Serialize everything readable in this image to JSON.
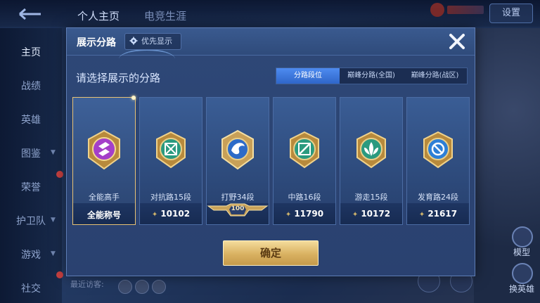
{
  "background": {
    "top_tabs": [
      "个人主页",
      "电竞生涯"
    ],
    "settings_label": "设置",
    "sidebar": [
      {
        "label": "主页",
        "active": true
      },
      {
        "label": "战绩"
      },
      {
        "label": "英雄"
      },
      {
        "label": "图鉴"
      },
      {
        "label": "荣誉"
      },
      {
        "label": "护卫队"
      },
      {
        "label": "游戏"
      },
      {
        "label": "社交"
      }
    ],
    "right_buttons": [
      "模型",
      "换英雄"
    ],
    "recent_visitors_label": "最近访客:"
  },
  "modal": {
    "title": "展示分路",
    "priority_button": "优先显示",
    "subtitle": "请选择展示的分路",
    "tabs": [
      {
        "label": "分路段位",
        "active": true
      },
      {
        "label": "巅峰分路(全国)"
      },
      {
        "label": "巅峰分路(战区)"
      }
    ],
    "cards": [
      {
        "name": "全能高手",
        "footer": "全能称号",
        "emblem": "allround-emblem-icon",
        "selected": true
      },
      {
        "name": "对抗路15段",
        "score": "10102",
        "emblem": "clash-lane-emblem-icon"
      },
      {
        "name": "打野34段",
        "badge": "100",
        "emblem": "jungle-emblem-icon"
      },
      {
        "name": "中路16段",
        "score": "11790",
        "emblem": "mid-lane-emblem-icon"
      },
      {
        "name": "游走15段",
        "score": "10172",
        "emblem": "roam-emblem-icon"
      },
      {
        "name": "发育路24段",
        "score": "21617",
        "emblem": "farm-lane-emblem-icon"
      }
    ],
    "confirm_label": "确定"
  },
  "colors": {
    "accent_gold": "#e8c274",
    "tab_active": "#3f7ae0",
    "panel": "#2c4574"
  }
}
